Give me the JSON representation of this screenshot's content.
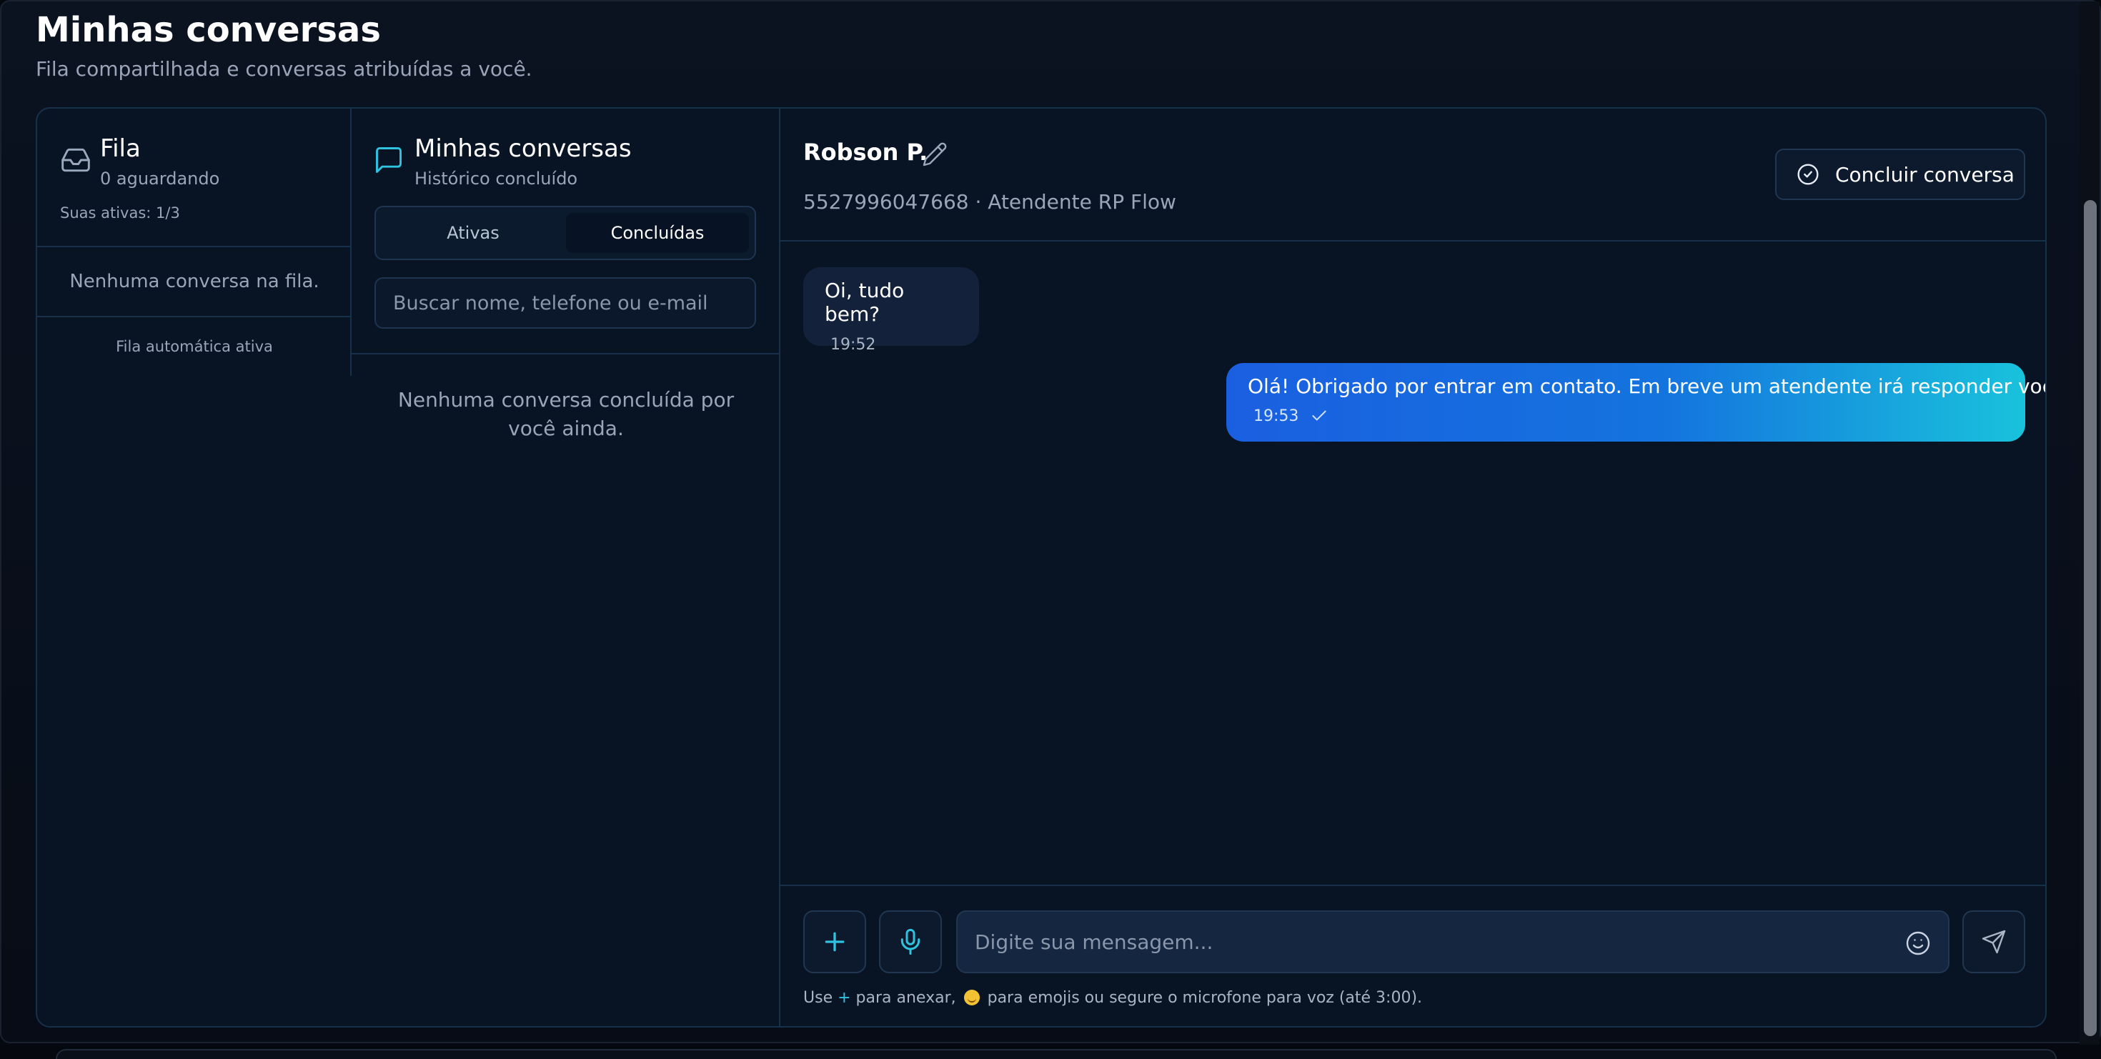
{
  "page": {
    "title": "Minhas conversas",
    "subtitle": "Fila compartilhada e conversas atribuídas a você."
  },
  "queue": {
    "title": "Fila",
    "waiting": "0 aguardando",
    "active_count": "Suas ativas: 1/3",
    "empty": "Nenhuma conversa na fila.",
    "auto": "Fila automática ativa",
    "icon": "inbox-icon"
  },
  "mine": {
    "title": "Minhas conversas",
    "subtitle": "Histórico concluído",
    "tabs": [
      {
        "label": "Ativas",
        "selected": false
      },
      {
        "label": "Concluídas",
        "selected": true
      }
    ],
    "search_placeholder": "Buscar nome, telefone ou e-mail",
    "empty": "Nenhuma conversa concluída por você ainda.",
    "icon": "chat-bubble-icon"
  },
  "chat": {
    "contact_name": "Robson P.",
    "contact_meta": "5527996047668 · Atendente RP Flow",
    "conclude_label": "Concluir conversa",
    "messages": [
      {
        "direction": "in",
        "text": "Oi, tudo bem?",
        "time": "19:52"
      },
      {
        "direction": "out",
        "text": "Olá! Obrigado por entrar em contato. Em breve um atendente irá responder você.",
        "time": "19:53"
      }
    ],
    "composer": {
      "placeholder": "Digite sua mensagem...",
      "hint_prefix": "Use ",
      "hint_plus": "+",
      "hint_mid": " para anexar, ",
      "hint_suffix": " para emojis ou segure o microfone para voz (até 3:00)."
    }
  },
  "colors": {
    "accent": "#2fc3e0",
    "outgoing_start": "#1a5fe0",
    "outgoing_end": "#19c2dc",
    "panel_bg": "#081323",
    "border": "#17314a"
  }
}
